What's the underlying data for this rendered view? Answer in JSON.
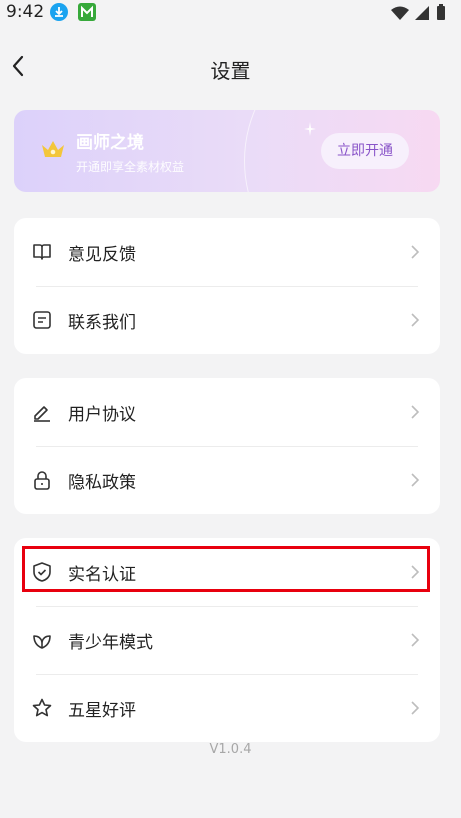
{
  "status": {
    "time": "9:42"
  },
  "header": {
    "title": "设置"
  },
  "vip": {
    "title": "画师之境",
    "subtitle": "开通即享全素材权益",
    "button": "立即开通",
    "accent": "#8a55c9"
  },
  "group1": [
    {
      "label": "意见反馈",
      "icon": "feedback-book-icon"
    },
    {
      "label": "联系我们",
      "icon": "contact-message-icon"
    }
  ],
  "group2": [
    {
      "label": "用户协议",
      "icon": "pen-icon"
    },
    {
      "label": "隐私政策",
      "icon": "lock-icon"
    }
  ],
  "group3": [
    {
      "label": "实名认证",
      "icon": "shield-icon",
      "highlighted": true
    },
    {
      "label": "青少年模式",
      "icon": "leaf-icon"
    },
    {
      "label": "五星好评",
      "icon": "star-icon"
    }
  ],
  "footer": {
    "version": "V1.0.4"
  },
  "colors": {
    "highlight": "#e8000e",
    "background": "#f3f3f4"
  }
}
